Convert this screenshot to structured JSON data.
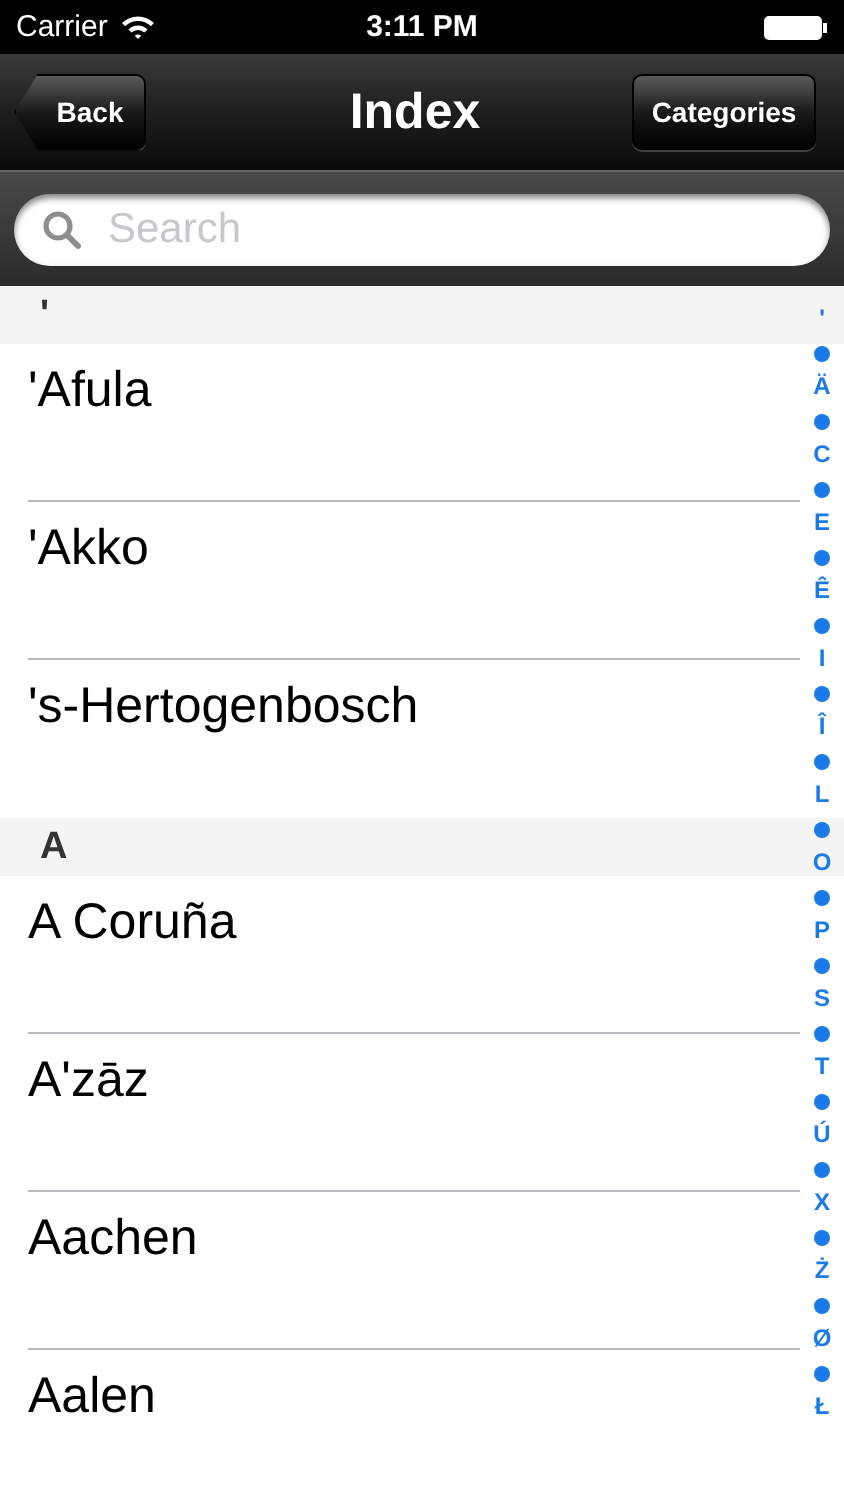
{
  "status_bar": {
    "carrier": "Carrier",
    "time": "3:11 PM"
  },
  "nav_bar": {
    "back": "Back",
    "title": "Index",
    "right_button": "Categories"
  },
  "search": {
    "placeholder": "Search"
  },
  "sections": [
    {
      "header": "'",
      "rows": [
        "'Afula",
        "'Akko",
        "'s-Hertogenbosch"
      ]
    },
    {
      "header": "A",
      "rows": [
        "A Coruña",
        "A'zāz",
        "Aachen",
        "Aalen"
      ]
    }
  ],
  "index": [
    {
      "kind": "letter",
      "label": "'"
    },
    {
      "kind": "dot"
    },
    {
      "kind": "letter",
      "label": "Ä"
    },
    {
      "kind": "dot"
    },
    {
      "kind": "letter",
      "label": "C"
    },
    {
      "kind": "dot"
    },
    {
      "kind": "letter",
      "label": "E"
    },
    {
      "kind": "dot"
    },
    {
      "kind": "letter",
      "label": "Ê"
    },
    {
      "kind": "dot"
    },
    {
      "kind": "letter",
      "label": "I"
    },
    {
      "kind": "dot"
    },
    {
      "kind": "letter",
      "label": "Î"
    },
    {
      "kind": "dot"
    },
    {
      "kind": "letter",
      "label": "L"
    },
    {
      "kind": "dot"
    },
    {
      "kind": "letter",
      "label": "O"
    },
    {
      "kind": "dot"
    },
    {
      "kind": "letter",
      "label": "P"
    },
    {
      "kind": "dot"
    },
    {
      "kind": "letter",
      "label": "S"
    },
    {
      "kind": "dot"
    },
    {
      "kind": "letter",
      "label": "T"
    },
    {
      "kind": "dot"
    },
    {
      "kind": "letter",
      "label": "Ú"
    },
    {
      "kind": "dot"
    },
    {
      "kind": "letter",
      "label": "X"
    },
    {
      "kind": "dot"
    },
    {
      "kind": "letter",
      "label": "Ż"
    },
    {
      "kind": "dot"
    },
    {
      "kind": "letter",
      "label": "Ø"
    },
    {
      "kind": "dot"
    },
    {
      "kind": "letter",
      "label": "Ł"
    }
  ]
}
